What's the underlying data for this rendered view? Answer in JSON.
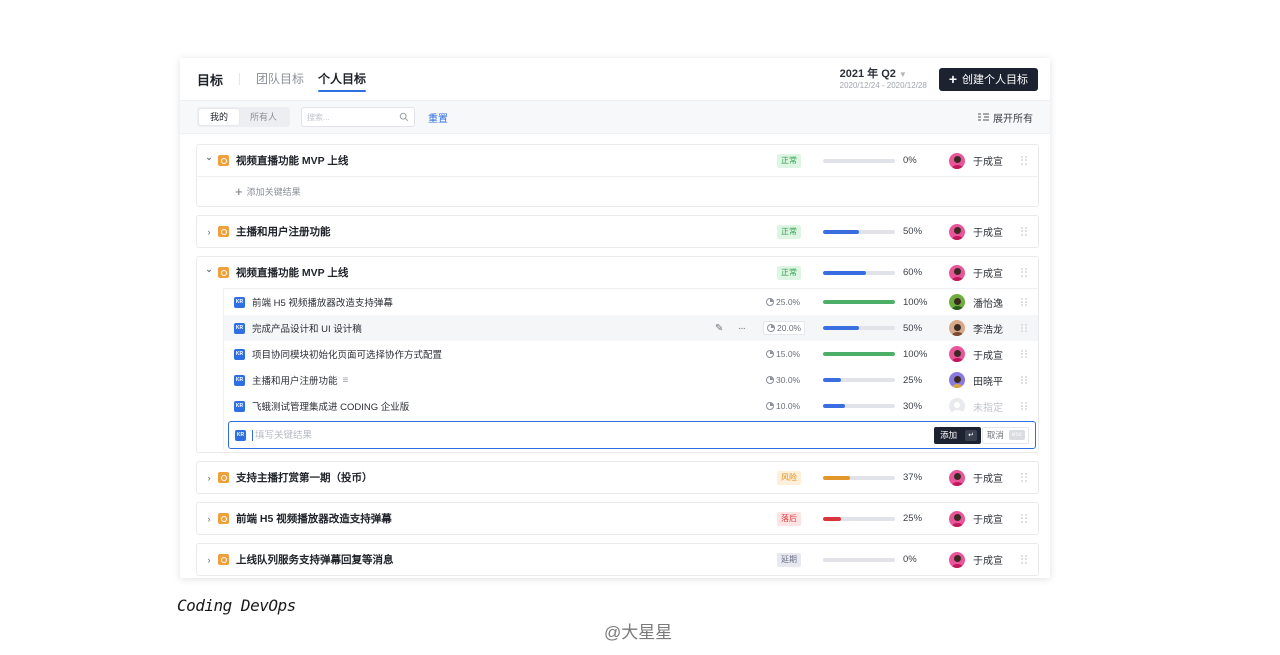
{
  "header": {
    "title": "目标",
    "tabs": [
      {
        "label": "团队目标",
        "active": false
      },
      {
        "label": "个人目标",
        "active": true
      }
    ],
    "quarter": "2021 年 Q2",
    "date_range": "2020/12/24 - 2020/12/28",
    "create_button": "创建个人目标"
  },
  "filter": {
    "segments": [
      {
        "label": "我的",
        "active": true
      },
      {
        "label": "所有人",
        "active": false
      }
    ],
    "search_placeholder": "搜索...",
    "reset_label": "重置",
    "expand_all_label": "展开所有"
  },
  "status_colors": {
    "正常": {
      "bg": "#dff5e4",
      "fg": "#2f9e4d"
    },
    "风险": {
      "bg": "#fdf0db",
      "fg": "#e38d1a"
    },
    "落后": {
      "bg": "#fde3e3",
      "fg": "#e03e3e"
    },
    "延期": {
      "bg": "#e8e9f0",
      "fg": "#6b7086"
    }
  },
  "objectives": [
    {
      "name": "视频直播功能 MVP 上线",
      "expanded": true,
      "status": "正常",
      "progress": 0,
      "progress_label": "0%",
      "bar_color": "#3a6ee0",
      "owner": "于成宣",
      "avatar": "pink",
      "add_kr_label": "添加关键结果"
    },
    {
      "name": "主播和用户注册功能",
      "expanded": false,
      "status": "正常",
      "progress": 50,
      "progress_label": "50%",
      "bar_color": "#3a6ee0",
      "owner": "于成宣",
      "avatar": "pink"
    },
    {
      "name": "视频直播功能 MVP 上线",
      "expanded": true,
      "status": "正常",
      "progress": 60,
      "progress_label": "60%",
      "bar_color": "#3a6ee0",
      "owner": "于成宣",
      "avatar": "pink",
      "key_results": [
        {
          "name": "前端 H5 视频播放器改造支持弹幕",
          "weight": "25.0%",
          "progress": 100,
          "progress_label": "100%",
          "bar_color": "#4caf68",
          "owner": "潘怡逸",
          "avatar": "green"
        },
        {
          "name": "完成产品设计和 UI 设计稿",
          "weight": "20.0%",
          "progress": 50,
          "progress_label": "50%",
          "bar_color": "#3a6ee0",
          "owner": "李浩龙",
          "avatar": "tan",
          "hover": true
        },
        {
          "name": "项目协同模块初始化页面可选择协作方式配置",
          "weight": "15.0%",
          "progress": 100,
          "progress_label": "100%",
          "bar_color": "#4caf68",
          "owner": "于成宣",
          "avatar": "pink"
        },
        {
          "name": "主播和用户注册功能",
          "weight": "30.0%",
          "progress": 25,
          "progress_label": "25%",
          "bar_color": "#3a6ee0",
          "owner": "田晓平",
          "avatar": "purple",
          "has_desc": true
        },
        {
          "name": "飞蛾测试管理集成进 CODING 企业版",
          "weight": "10.0%",
          "progress": 30,
          "progress_label": "30%",
          "bar_color": "#3a6ee0",
          "owner": "未指定",
          "avatar": "none"
        }
      ],
      "new_kr": {
        "placeholder": "填写关键结果",
        "add_label": "添加",
        "add_key": "↵",
        "cancel_label": "取消",
        "cancel_key": "esc"
      }
    },
    {
      "name": "支持主播打赏第一期（投币）",
      "expanded": false,
      "status": "风险",
      "progress": 37,
      "progress_label": "37%",
      "bar_color": "#e3962a",
      "owner": "于成宣",
      "avatar": "pink"
    },
    {
      "name": "前端 H5 视频播放器改造支持弹幕",
      "expanded": false,
      "status": "落后",
      "progress": 25,
      "progress_label": "25%",
      "bar_color": "#d9333b",
      "owner": "于成宣",
      "avatar": "pink"
    },
    {
      "name": "上线队列服务支持弹幕回复等消息",
      "expanded": false,
      "status": "延期",
      "progress": 0,
      "progress_label": "0%",
      "bar_color": "#3a6ee0",
      "owner": "于成宣",
      "avatar": "pink"
    }
  ],
  "kr_icon_label": "KR",
  "caption": "Coding DevOps",
  "watermark": "@大星星"
}
